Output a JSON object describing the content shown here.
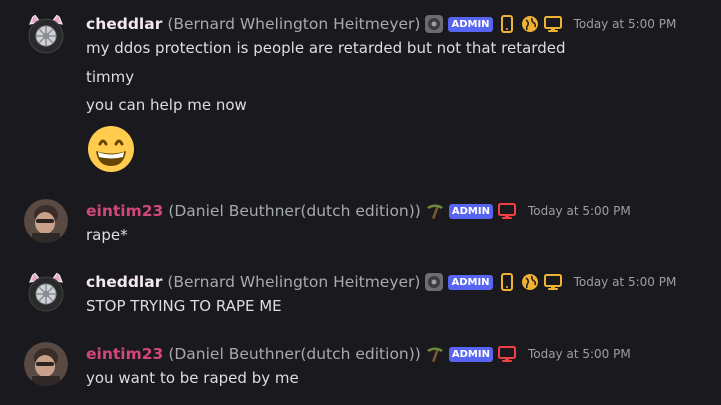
{
  "messages": [
    {
      "username": "cheddlar",
      "realname": "(Bernard Whelington Heitmeyer)",
      "badge": "ADMIN",
      "timestamp": "Today at 5:00 PM",
      "lines": [
        "my ddos protection is people are retarded but not that retarded",
        "timmy",
        "you can help me now"
      ],
      "emoji": "grinning-face"
    },
    {
      "username": "eintim23",
      "realname": "(Daniel Beuthner(dutch edition))",
      "badge": "ADMIN",
      "timestamp": "Today at 5:00 PM",
      "lines": [
        "rape*"
      ]
    },
    {
      "username": "cheddlar",
      "realname": "(Bernard Whelington Heitmeyer)",
      "badge": "ADMIN",
      "timestamp": "Today at 5:00 PM",
      "lines": [
        "STOP TRYING TO RAPE ME"
      ]
    },
    {
      "username": "eintim23",
      "realname": "(Daniel Beuthner(dutch edition))",
      "badge": "ADMIN",
      "timestamp": "Today at 5:00 PM",
      "lines": [
        "you want to be raped by me"
      ]
    }
  ],
  "colors": {
    "background": "#1a1a1e",
    "cheddlar_name": "#f3e8ee",
    "eintim_name": "#d2477a",
    "admin_badge": "#5865f2",
    "status_orange": "#f0b232",
    "status_red": "#f23f43"
  },
  "icons": {
    "cheddlar_devices": [
      "mobile-icon",
      "web-globe-icon",
      "desktop-icon"
    ],
    "eintim_devices": [
      "desktop-icon"
    ]
  }
}
